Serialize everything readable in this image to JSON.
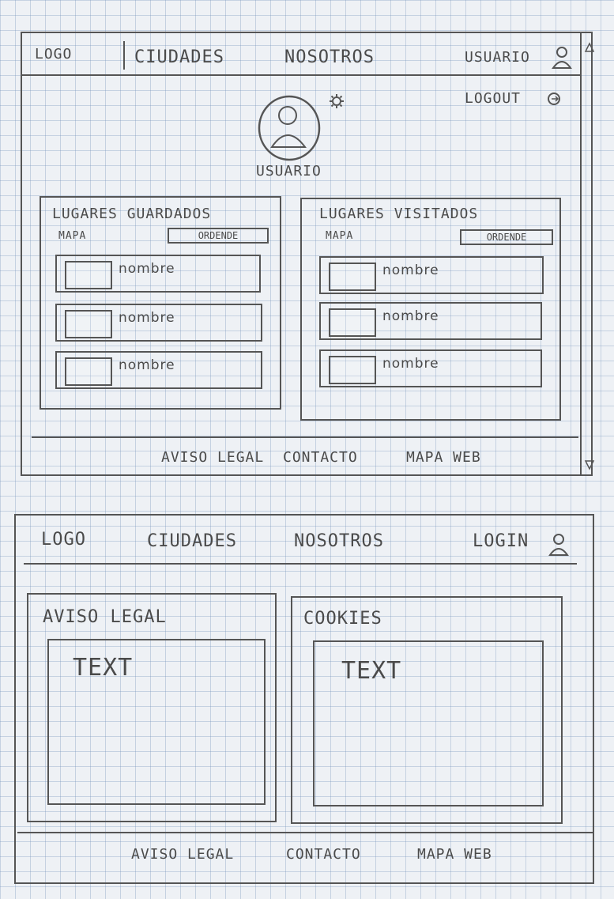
{
  "screen1": {
    "header": {
      "logo": "LOGO",
      "nav": [
        "CIUDADES",
        "NOSOTROS"
      ],
      "user_label": "USUARIO",
      "user_icon": "person-icon",
      "logout_label": "LOGOUT",
      "logout_icon": "logout-icon",
      "scroll_up_icon": "triangle-up-icon",
      "scroll_down_icon": "triangle-down-icon"
    },
    "profile": {
      "avatar_icon": "avatar-icon",
      "settings_icon": "gear-icon",
      "username": "USUARIO"
    },
    "saved_places": {
      "title": "LUGARES GUARDADOS",
      "map_label": "MAPA",
      "sort_label": "ORDENDE",
      "items": [
        "nombre",
        "nombre",
        "nombre"
      ]
    },
    "visited_places": {
      "title": "LUGARES VISITADOS",
      "map_label": "MAPA",
      "sort_label": "ORDENDE",
      "items": [
        "nombre",
        "nombre",
        "nombre"
      ]
    },
    "footer": {
      "links": [
        "AVISO LEGAL",
        "CONTACTO",
        "MAPA WEB"
      ]
    }
  },
  "screen2": {
    "header": {
      "logo": "LOGO",
      "nav": [
        "CIUDADES",
        "NOSOTROS"
      ],
      "login_label": "LOGIN",
      "login_icon": "person-icon"
    },
    "legal": {
      "title": "AVISO LEGAL",
      "body": "TEXT"
    },
    "cookies": {
      "title": "COOKIES",
      "body": "TEXT"
    },
    "footer": {
      "links": [
        "AVISO LEGAL",
        "CONTACTO",
        "MAPA WEB"
      ]
    }
  }
}
